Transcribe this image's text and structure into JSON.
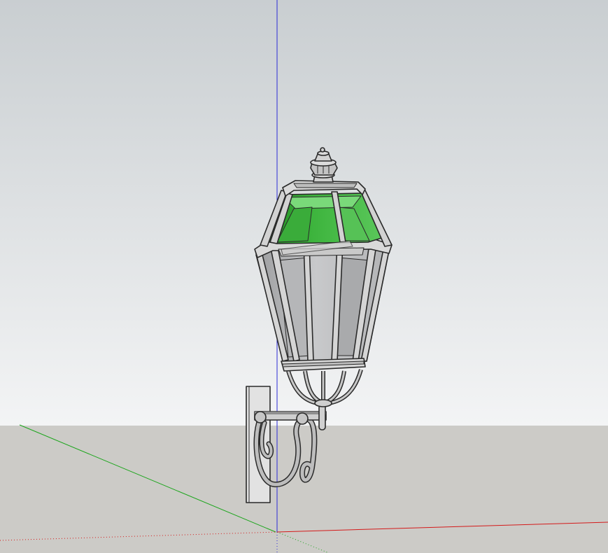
{
  "viewport": {
    "sky_top": "#c9ced1",
    "sky_bottom": "#f2f4f5",
    "ground_color": "#cccbc7",
    "axis_red": "#d41a1a",
    "axis_green": "#1aa51a",
    "axis_blue": "#1a1ad4",
    "glass_green": "#2fa02f",
    "glass_green_light": "#6fd36f",
    "glass_clear": "#c4c5c7",
    "metal_light": "#dadada",
    "metal_mid": "#b8b8b8",
    "edge": "#2a2a2a"
  },
  "model": {
    "object": "wall-lantern",
    "icon": "lantern-model"
  }
}
